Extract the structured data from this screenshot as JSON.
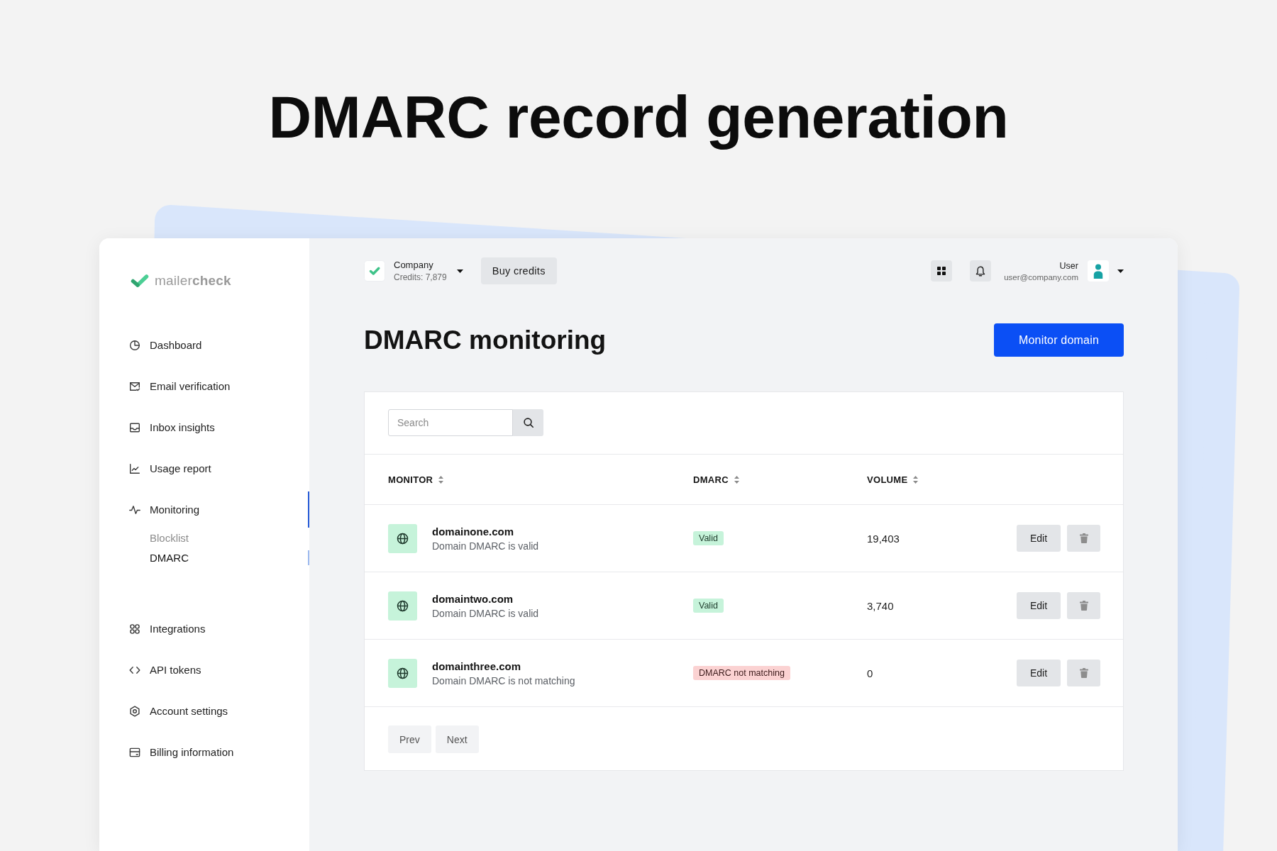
{
  "headline": "DMARC record generation",
  "sidebar": {
    "logo": "mailer**check**",
    "groups": [
      {
        "items": [
          {
            "label": "Dashboard",
            "selected": false
          },
          {
            "label": "Email verification",
            "selected": false
          },
          {
            "label": "Inbox insights",
            "selected": false
          },
          {
            "label": "Usage report",
            "selected": false
          },
          {
            "label": "Monitoring",
            "selected": true,
            "children": [
              {
                "label": "Blocklist",
                "selected": false
              },
              {
                "label": "DMARC",
                "selected": true
              }
            ]
          }
        ]
      },
      {
        "items": [
          {
            "label": "Integrations",
            "selected": false
          },
          {
            "label": "API tokens",
            "selected": false
          },
          {
            "label": "Account settings",
            "selected": false
          },
          {
            "label": "Billing information",
            "selected": false
          }
        ]
      }
    ]
  },
  "top_bar": {
    "company": {
      "name": "Company",
      "credits": "Credits: 7,879"
    },
    "buy_button": "Buy credits",
    "user": {
      "name": "User",
      "email": "user@company.com"
    }
  },
  "page": {
    "title": "DMARC monitoring",
    "primary_button": "Monitor domain"
  },
  "table": {
    "search": {
      "placeholder": "Search"
    },
    "columns": [
      {
        "label": "MONITOR",
        "sortable": true
      },
      {
        "label": "DMARC",
        "sortable": true
      },
      {
        "label": "VOLUME",
        "sortable": true
      }
    ],
    "rows": [
      {
        "domain": "domainone.com",
        "description": "Domain DMARC is valid",
        "status": {
          "kind": "valid",
          "label": "Valid"
        },
        "volume": "19,403",
        "edit_button": "Edit"
      },
      {
        "domain": "domaintwo.com",
        "description": "Domain DMARC is valid",
        "status": {
          "kind": "valid",
          "label": "Valid"
        },
        "volume": "3,740",
        "edit_button": "Edit"
      },
      {
        "domain": "domainthree.com",
        "description": "Domain DMARC is not matching",
        "status": {
          "kind": "mismatch",
          "label": "DMARC not matching"
        },
        "volume": "0",
        "edit_button": "Edit"
      }
    ],
    "pagination": [
      "Prev",
      "Next"
    ]
  }
}
